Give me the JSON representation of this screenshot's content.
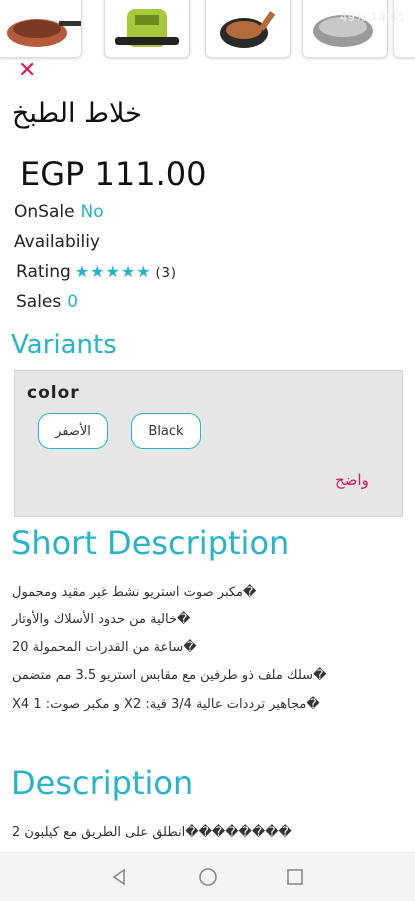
{
  "status": {
    "time": "49% 14:45"
  },
  "product": {
    "title": "خلاط الطبخ",
    "price": "EGP 111.00",
    "onsale_label": "OnSale",
    "onsale_value": "No",
    "availability_label": "Availabiliy",
    "rating_label": "Rating",
    "rating_stars": 5,
    "rating_stars_text": "★★★★★",
    "rating_count": "(3)",
    "sales_label": "Sales",
    "sales_value": "0"
  },
  "variants": {
    "heading": "Variants",
    "color_label": "color",
    "options": [
      "الأصفر",
      "Black"
    ],
    "clear_label": "واضح"
  },
  "short_description": {
    "heading": "Short Description",
    "lines": [
      "مكبر صوت استريو نشط غير مقيد ومحمول�",
      "خالية من حدود الأسلاك والأوتار�",
      "ساعة من القدرات المحمولة 20�",
      "سلك ملف ذو طرفين مع مقابس استريو 3.5 مم متضمن�",
      "X4 و مكبر صوت: 1 Xمجاهير ترددات عالية 3/4 قية: 2�"
    ]
  },
  "description": {
    "heading": "Description",
    "first_line": "انطلق على الطريق مع كيلبون 2��������"
  },
  "colors": {
    "accent": "#26b5c8",
    "danger": "#d81b60"
  }
}
